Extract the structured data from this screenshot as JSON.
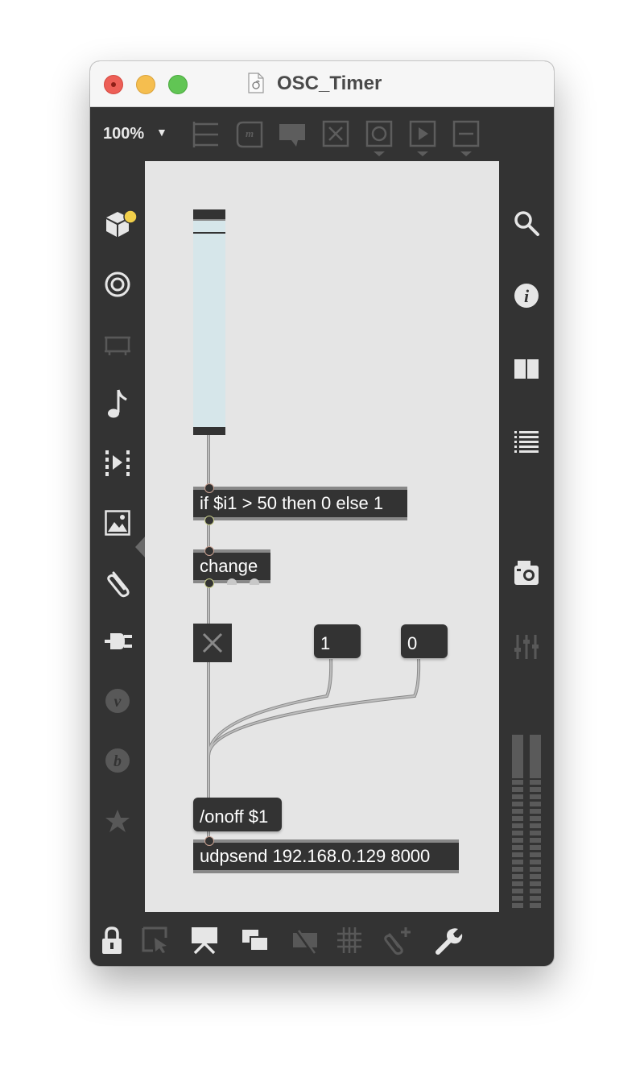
{
  "window": {
    "title": "OSC_Timer"
  },
  "toolbar": {
    "zoom_label": "100%"
  },
  "patch": {
    "expr_object": "if $i1 > 50 then 0 else 1",
    "change_object": "change",
    "msg_one": "1",
    "msg_zero": "0",
    "onoff_message": "/onoff $1",
    "udpsend_object": "udpsend 192.168.0.129 8000"
  },
  "colors": {
    "canvas": "#e5e5e5",
    "chrome": "#333333",
    "object": "#333333",
    "slider_fill": "#d6e6ea",
    "patch_cord": "#a8a8a8",
    "badge": "#f1cf4a"
  },
  "icons": {
    "left_sidebar": [
      "packages-icon",
      "target-icon",
      "device-icon",
      "music-note-icon",
      "video-icon",
      "image-icon",
      "paperclip-icon",
      "plug-icon",
      "v-icon",
      "b-icon",
      "star-icon"
    ],
    "right_sidebar": [
      "search-icon",
      "info-icon",
      "book-icon",
      "list-icon",
      "snapshot-icon",
      "mixer-icon"
    ],
    "bottom_toolbar": [
      "lock-icon",
      "select-icon",
      "presentation-icon",
      "windows-icon",
      "hide-icon",
      "grid-icon",
      "attach-icon",
      "wrench-icon"
    ],
    "top_toolbar": [
      "object-icon",
      "message-icon",
      "comment-icon",
      "toggle-icon",
      "button-icon",
      "play-icon",
      "slider-icon"
    ]
  }
}
